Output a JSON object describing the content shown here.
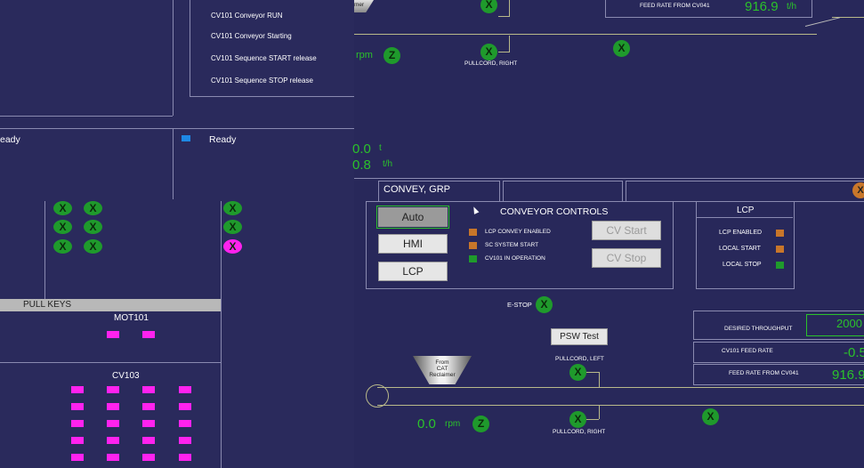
{
  "left_panel": {
    "messages": [
      "CV101 Conveyor RUN",
      "CV101 Conveyor Starting",
      "CV101 Sequence START release",
      "CV101 Sequence STOP release"
    ],
    "status_left": "eady",
    "status_right": "Ready",
    "pull_keys_label": "PULL KEYS",
    "mot_label": "MOT101",
    "cv_label": "CV103",
    "x_symbol": "X"
  },
  "top_area": {
    "feed_label": "FEED RATE FROM CV041",
    "feed_value": "916.9",
    "feed_unit": "t/h",
    "pullcord_right": "PULLCORD, RIGHT",
    "rpm_unit": "rpm",
    "z_symbol": "Z",
    "val1": "0.0",
    "val1_unit": "t",
    "val2": "0.8",
    "val2_unit": "t/h",
    "reclaimer_cut": "mer"
  },
  "group_label": "CONVEY, GRP",
  "conveyor_controls": {
    "title": "CONVEYOR CONTROLS",
    "buttons": [
      "Auto",
      "HMI",
      "LCP"
    ],
    "legend": [
      {
        "label": "LCP CONVEY ENABLED",
        "color": "#c8762a"
      },
      {
        "label": "SC SYSTEM START",
        "color": "#c8762a"
      },
      {
        "label": "CV101 IN OPERATION",
        "color": "#1f9a2c"
      }
    ],
    "cv_start": "CV Start",
    "cv_stop": "CV Stop"
  },
  "lcp_panel": {
    "title": "LCP",
    "items": [
      {
        "label": "LCP ENABLED",
        "color": "#c8762a"
      },
      {
        "label": "LOCAL START",
        "color": "#c8762a"
      },
      {
        "label": "LOCAL STOP",
        "color": "#1f9a2c"
      }
    ]
  },
  "estop_label": "E-STOP",
  "psw_test": "PSW Test",
  "pullcord_left": "PULLCORD, LEFT",
  "pullcord_right_bottom": "PULLCORD, RIGHT",
  "reclaimer_label": "From\nCAT\nReclaimer",
  "rpm_value": "0.0",
  "rpm_unit": "rpm",
  "throughput": {
    "desired_label": "DESIRED THROUGHPUT",
    "desired_value": "2000",
    "feed_rate_label": "CV101 FEED RATE",
    "feed_rate_value": "-0.5",
    "from_cv041_label": "FEED RATE FROM CV041",
    "from_cv041_value": "916.9"
  },
  "colors": {
    "background": "#28285a",
    "indicator_green": "#1f9a2c",
    "indicator_magenta": "#ff22ee",
    "value_green": "#2bc22b",
    "orange": "#c8762a",
    "status_blue": "#1e88e5"
  }
}
